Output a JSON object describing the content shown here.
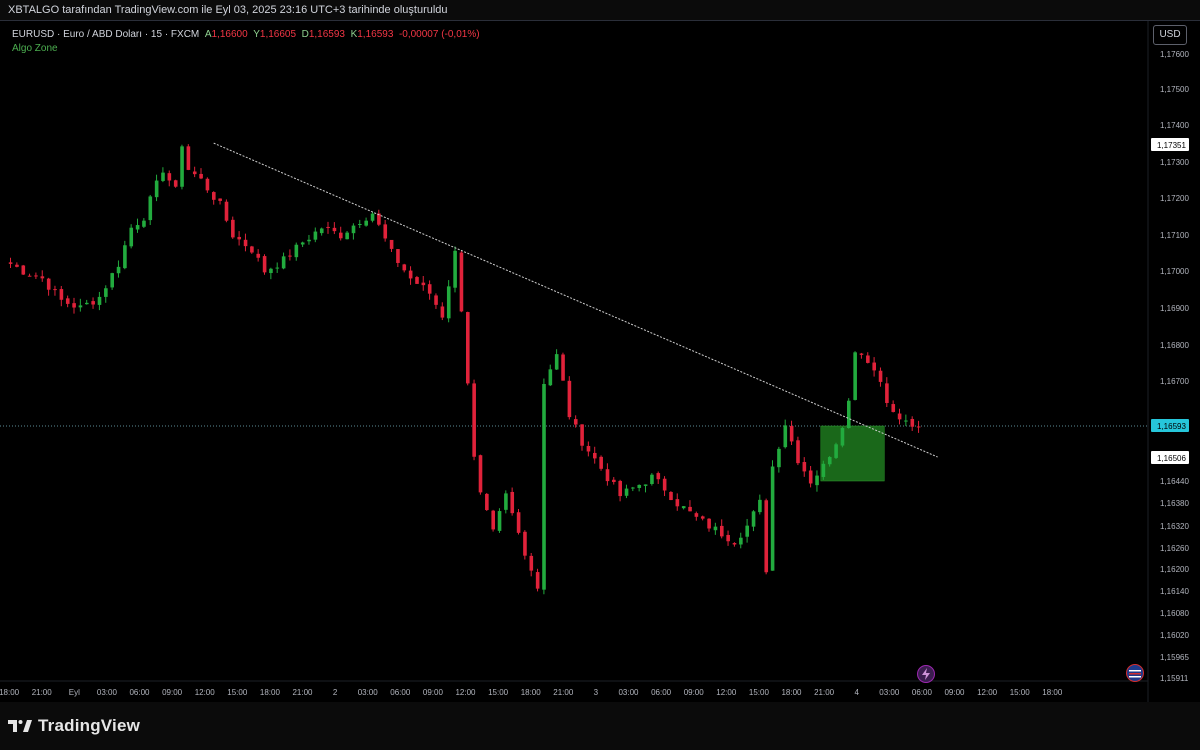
{
  "header": {
    "caption": "XBTALGO tarafından TradingView.com ile Eyl 03, 2025 23:16 UTC+3 tarihinde oluşturuldu"
  },
  "legend": {
    "symbol": "EURUSD · Euro / ABD Doları · 15 · FXCM",
    "a_label": "A",
    "a_value": "1,16600",
    "y_label": "Y",
    "y_value": "1,16605",
    "d_label": "D",
    "d_value": "1,16593",
    "k_label": "K",
    "k_value": "1,16593",
    "change": "-0,00007 (-0,01%)",
    "indicator": "Algo Zone"
  },
  "currency_button": "USD",
  "footer": {
    "brand": "TradingView"
  },
  "colors": {
    "up": "#22ab3e",
    "down": "#e0223a",
    "zone": "#1f7a1f",
    "current": "#26c6da",
    "trendline": "#cfcfcf"
  },
  "chart_data": {
    "type": "candlestick",
    "y_ticks": [
      "1,17600",
      "1,17500",
      "1,17400",
      "1,17300",
      "1,17200",
      "1,17100",
      "1,17000",
      "1,16900",
      "1,16800",
      "1,16700",
      "1,16593",
      "1,16506",
      "1,16440",
      "1,16380",
      "1,16320",
      "1,16260",
      "1,16200",
      "1,16140",
      "1,16080",
      "1,16020",
      "1,15965",
      "1,15911"
    ],
    "x_ticks": [
      "18:00",
      "21:00",
      "Eyl",
      "03:00",
      "06:00",
      "09:00",
      "12:00",
      "15:00",
      "18:00",
      "21:00",
      "2",
      "03:00",
      "06:00",
      "09:00",
      "12:00",
      "15:00",
      "18:00",
      "21:00",
      "3",
      "03:00",
      "06:00",
      "09:00",
      "12:00",
      "15:00",
      "18:00",
      "21:00",
      "4",
      "03:00",
      "06:00",
      "09:00",
      "12:00",
      "15:00",
      "18:00"
    ],
    "price_labels": [
      {
        "price": "1,17351",
        "style": "white"
      },
      {
        "price": "1,16593",
        "style": "cyan"
      },
      {
        "price": "1,16506",
        "style": "white"
      }
    ],
    "path_points": [
      [
        0,
        1.1702
      ],
      [
        2,
        1.17
      ],
      [
        5,
        1.1698
      ],
      [
        8,
        1.1692
      ],
      [
        11,
        1.169
      ],
      [
        14,
        1.1693
      ],
      [
        17,
        1.1702
      ],
      [
        19,
        1.1712
      ],
      [
        21,
        1.1715
      ],
      [
        24,
        1.1728
      ],
      [
        26,
        1.1722
      ],
      [
        27,
        1.1735
      ],
      [
        28,
        1.1728
      ],
      [
        30,
        1.1725
      ],
      [
        33,
        1.1718
      ],
      [
        35,
        1.171
      ],
      [
        38,
        1.1706
      ],
      [
        40,
        1.17
      ],
      [
        43,
        1.1703
      ],
      [
        46,
        1.1708
      ],
      [
        49,
        1.1712
      ],
      [
        52,
        1.171
      ],
      [
        55,
        1.1714
      ],
      [
        57,
        1.1716
      ],
      [
        60,
        1.1705
      ],
      [
        63,
        1.1698
      ],
      [
        66,
        1.1694
      ],
      [
        68,
        1.1688
      ],
      [
        70,
        1.1705
      ],
      [
        71,
        1.169
      ],
      [
        72,
        1.167
      ],
      [
        73,
        1.165
      ],
      [
        74,
        1.164
      ],
      [
        76,
        1.163
      ],
      [
        78,
        1.164
      ],
      [
        80,
        1.163
      ],
      [
        82,
        1.162
      ],
      [
        83,
        1.1615
      ],
      [
        84,
        1.167
      ],
      [
        86,
        1.1677
      ],
      [
        88,
        1.1662
      ],
      [
        90,
        1.1655
      ],
      [
        92,
        1.165
      ],
      [
        94,
        1.1645
      ],
      [
        96,
        1.164
      ],
      [
        98,
        1.1642
      ],
      [
        101,
        1.1645
      ],
      [
        103,
        1.1642
      ],
      [
        105,
        1.1638
      ],
      [
        108,
        1.1634
      ],
      [
        110,
        1.1632
      ],
      [
        112,
        1.163
      ],
      [
        114,
        1.1628
      ],
      [
        116,
        1.1632
      ],
      [
        118,
        1.1638
      ],
      [
        119,
        1.162
      ],
      [
        120,
        1.1648
      ],
      [
        122,
        1.166
      ],
      [
        124,
        1.165
      ],
      [
        126,
        1.1644
      ],
      [
        128,
        1.1648
      ],
      [
        130,
        1.1655
      ],
      [
        132,
        1.1665
      ],
      [
        133,
        1.1679
      ],
      [
        135,
        1.1676
      ],
      [
        137,
        1.167
      ],
      [
        139,
        1.1662
      ],
      [
        141,
        1.166
      ],
      [
        143,
        1.1659
      ]
    ],
    "trendline": {
      "from": [
        32,
        1.17351
      ],
      "to": [
        146,
        1.16506
      ]
    },
    "zone": {
      "from_bar": 128,
      "to_bar": 138,
      "top": 1.16593,
      "bottom": 1.1644
    },
    "current_price": 1.16593
  }
}
